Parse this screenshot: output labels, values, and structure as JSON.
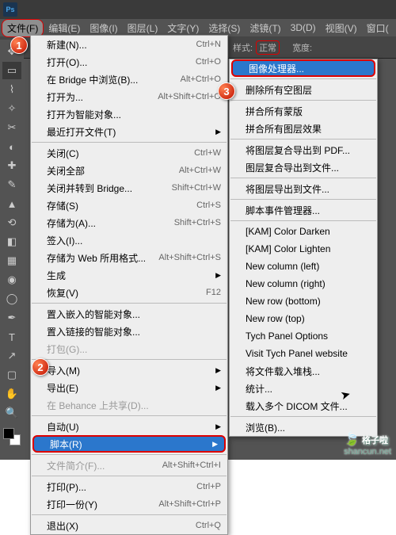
{
  "titlebar": {
    "logo": "Ps"
  },
  "menubar": {
    "items": [
      "文件(F)",
      "编辑(E)",
      "图像(I)",
      "图层(L)",
      "文字(Y)",
      "选择(S)",
      "滤镜(T)",
      "3D(D)",
      "视图(V)",
      "窗口("
    ]
  },
  "optbar": {
    "label1": "样式:",
    "value1": "正常",
    "label2": "宽度:"
  },
  "file_menu": {
    "items": [
      {
        "label": "新建(N)...",
        "shortcut": "Ctrl+N"
      },
      {
        "label": "打开(O)...",
        "shortcut": "Ctrl+O"
      },
      {
        "label": "在 Bridge 中浏览(B)...",
        "shortcut": "Alt+Ctrl+O"
      },
      {
        "label": "打开为...",
        "shortcut": "Alt+Shift+Ctrl+O"
      },
      {
        "label": "打开为智能对象..."
      },
      {
        "label": "最近打开文件(T)",
        "sub": true
      },
      {
        "sep": true
      },
      {
        "label": "关闭(C)",
        "shortcut": "Ctrl+W"
      },
      {
        "label": "关闭全部",
        "shortcut": "Alt+Ctrl+W"
      },
      {
        "label": "关闭并转到 Bridge...",
        "shortcut": "Shift+Ctrl+W"
      },
      {
        "label": "存储(S)",
        "shortcut": "Ctrl+S"
      },
      {
        "label": "存储为(A)...",
        "shortcut": "Shift+Ctrl+S"
      },
      {
        "label": "签入(I)..."
      },
      {
        "label": "存储为 Web 所用格式...",
        "shortcut": "Alt+Shift+Ctrl+S"
      },
      {
        "label": "生成",
        "sub": true
      },
      {
        "label": "恢复(V)",
        "shortcut": "F12"
      },
      {
        "sep": true
      },
      {
        "label": "置入嵌入的智能对象..."
      },
      {
        "label": "置入链接的智能对象..."
      },
      {
        "label": "打包(G)...",
        "dis": true
      },
      {
        "sep": true
      },
      {
        "label": "导入(M)",
        "sub": true
      },
      {
        "label": "导出(E)",
        "sub": true
      },
      {
        "label": "在 Behance 上共享(D)...",
        "dis": true
      },
      {
        "sep": true
      },
      {
        "label": "自动(U)",
        "sub": true
      },
      {
        "label": "脚本(R)",
        "sub": true,
        "hl": true,
        "boxed": true
      },
      {
        "sep": true
      },
      {
        "label": "文件简介(F)...",
        "shortcut": "Alt+Shift+Ctrl+I",
        "dis": true
      },
      {
        "sep": true
      },
      {
        "label": "打印(P)...",
        "shortcut": "Ctrl+P"
      },
      {
        "label": "打印一份(Y)",
        "shortcut": "Alt+Shift+Ctrl+P"
      },
      {
        "sep": true
      },
      {
        "label": "退出(X)",
        "shortcut": "Ctrl+Q"
      }
    ]
  },
  "script_menu": {
    "items": [
      {
        "label": "图像处理器...",
        "hl": true,
        "boxed": true
      },
      {
        "sep": true
      },
      {
        "label": "删除所有空图层"
      },
      {
        "sep": true
      },
      {
        "label": "拼合所有蒙版"
      },
      {
        "label": "拼合所有图层效果"
      },
      {
        "sep": true
      },
      {
        "label": "将图层复合导出到 PDF..."
      },
      {
        "label": "图层复合导出到文件..."
      },
      {
        "sep": true
      },
      {
        "label": "将图层导出到文件..."
      },
      {
        "sep": true
      },
      {
        "label": "脚本事件管理器..."
      },
      {
        "sep": true
      },
      {
        "label": "[KAM] Color Darken"
      },
      {
        "label": "[KAM] Color Lighten"
      },
      {
        "label": "New column (left)"
      },
      {
        "label": "New column (right)"
      },
      {
        "label": "New row (bottom)"
      },
      {
        "label": "New row (top)"
      },
      {
        "label": "Tych Panel Options"
      },
      {
        "label": "Visit Tych Panel website"
      },
      {
        "label": "将文件载入堆栈..."
      },
      {
        "label": "统计..."
      },
      {
        "label": "载入多个 DICOM 文件..."
      },
      {
        "sep": true
      },
      {
        "label": "浏览(B)..."
      }
    ]
  },
  "badges": {
    "b1": "1",
    "b2": "2",
    "b3": "3"
  },
  "watermark": {
    "brand": "格子啦",
    "url": "shancun.net"
  }
}
